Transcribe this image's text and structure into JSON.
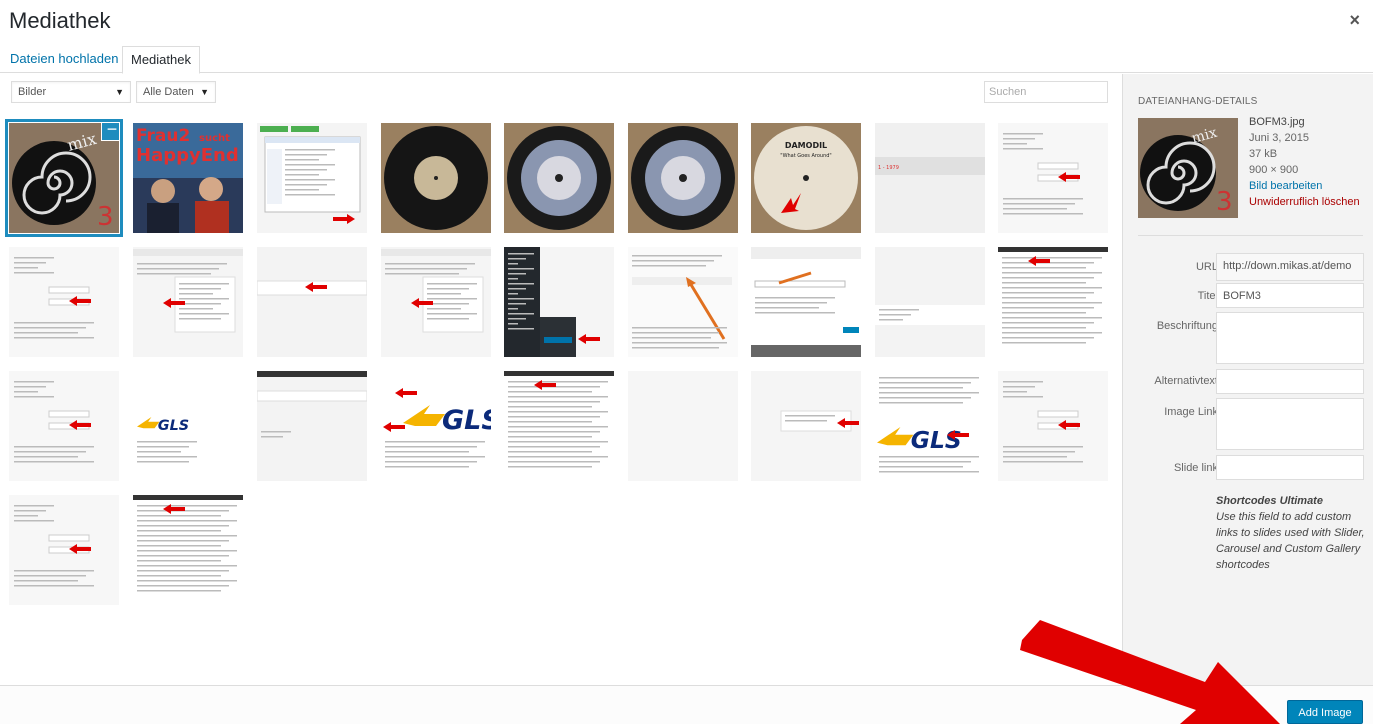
{
  "header": {
    "title": "Mediathek",
    "close_symbol": "×"
  },
  "tabs": [
    {
      "label": "Dateien hochladen",
      "active": false
    },
    {
      "label": "Mediathek",
      "active": true
    }
  ],
  "toolbar": {
    "type_filter": "Bilder",
    "date_filter": "Alle Daten",
    "search_placeholder": "Suchen"
  },
  "grid": {
    "rows": [
      [
        {
          "kind": "record-spiral",
          "selected": true
        },
        {
          "kind": "poster",
          "text1": "Frau2",
          "text2": "sucht",
          "text3": "HappyEnd"
        },
        {
          "kind": "screenshot-file-dialog"
        },
        {
          "kind": "record-brown"
        },
        {
          "kind": "record-cd"
        },
        {
          "kind": "record-cd"
        },
        {
          "kind": "record-damodil",
          "text1": "Damodil",
          "text2": "\"What Goes Around\""
        },
        {
          "kind": "screenshot-blank-bar"
        },
        {
          "kind": "screenshot-form"
        }
      ],
      [
        {
          "kind": "screenshot-form"
        },
        {
          "kind": "screenshot-settings"
        },
        {
          "kind": "screenshot-bar"
        },
        {
          "kind": "screenshot-settings"
        },
        {
          "kind": "screenshot-dark-menu"
        },
        {
          "kind": "screenshot-editor-orange"
        },
        {
          "kind": "screenshot-dialog-orange"
        },
        {
          "kind": "screenshot-blank-form"
        },
        {
          "kind": "screenshot-text"
        }
      ],
      [
        {
          "kind": "screenshot-form"
        },
        {
          "kind": "gls-small"
        },
        {
          "kind": "screenshot-bar-dark"
        },
        {
          "kind": "gls-big"
        },
        {
          "kind": "screenshot-text"
        },
        {
          "kind": "blank"
        },
        {
          "kind": "screenshot-small-dialog"
        },
        {
          "kind": "gls-editor"
        },
        {
          "kind": "screenshot-form"
        }
      ],
      [
        {
          "kind": "screenshot-form"
        },
        {
          "kind": "screenshot-text"
        }
      ]
    ]
  },
  "sidebar": {
    "heading": "DATEIANHANG-DETAILS",
    "filename": "BOFM3.jpg",
    "date": "Juni 3, 2015",
    "size": "37 kB",
    "dimensions": "900 × 900",
    "edit_link": "Bild bearbeiten",
    "delete_link": "Unwiderruflich löschen",
    "fields": {
      "url_label": "URL",
      "url_value": "http://down.mikas.at/demo",
      "title_label": "Titel",
      "title_value": "BOFM3",
      "caption_label": "Beschriftung",
      "alt_label": "Alternativtext",
      "imagelink_label": "Image Link",
      "slidelink_label": "Slide link"
    },
    "note_title": "Shortcodes Ultimate",
    "note_text": "Use this field to add custom links to slides used with Slider, Carousel and Custom Gallery shortcodes"
  },
  "footer": {
    "add_button": "Add Image"
  },
  "colors": {
    "accent": "#0085ba",
    "link": "#0073aa",
    "danger": "#a00000",
    "arrow": "#e00000"
  }
}
